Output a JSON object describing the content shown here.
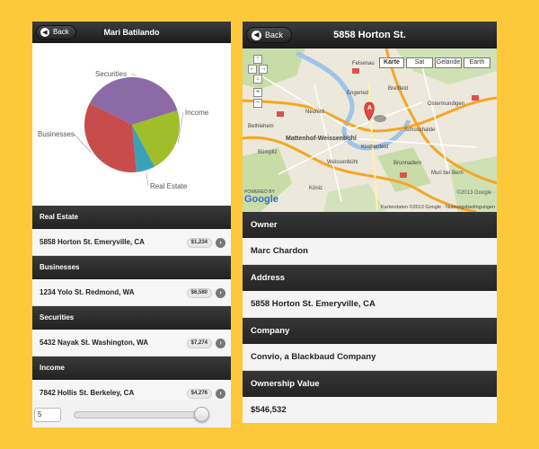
{
  "left": {
    "header": {
      "back_label": "Back",
      "title": "Mari Batilando"
    },
    "chart_data": {
      "type": "pie",
      "slices": [
        {
          "label": "Securities",
          "value": 7274,
          "color": "#8b6aa6"
        },
        {
          "label": "Income",
          "value": 4276,
          "color": "#9fbe2a"
        },
        {
          "label": "Real Estate",
          "value": 1234,
          "color": "#3ba1b8"
        },
        {
          "label": "Businesses",
          "value": 6580,
          "color": "#c74d4d"
        }
      ]
    },
    "sections": [
      {
        "title": "Real Estate",
        "address": "5858 Horton St. Emeryville, CA",
        "badge": "$1,234"
      },
      {
        "title": "Businesses",
        "address": "1234 Yolo St. Redmond, WA",
        "badge": "$6,580"
      },
      {
        "title": "Securities",
        "address": "5432 Nayak St. Washington, WA",
        "badge": "$7,274"
      },
      {
        "title": "Income",
        "address": "7842 Hollis St. Berkeley, CA",
        "badge": "$4,276"
      }
    ],
    "slider": {
      "value": "5",
      "position": 1.0
    }
  },
  "right": {
    "header": {
      "back_label": "Back",
      "title": "5858 Horton St."
    },
    "map": {
      "types": [
        "Karte",
        "Sat",
        "Gelände",
        "Earth"
      ],
      "labels": {
        "felsenau": "Felsenau",
        "breitfeld": "Breitfeld",
        "engeried": "Engeried",
        "ostermundigen": "Ostermundigen",
        "neufeld": "Neufeld",
        "bethlehem": "Bethlehem",
        "mattenhof": "Mattenhof-Weissenbühl",
        "kirchenfeld": "Kirchenfeld",
        "schosshalde": "Schosshalde",
        "bumpliz": "Bümpliz",
        "weissenbuhl": "Weissenbühl",
        "brunnadern": "Brunnadern",
        "muri": "Muri bei Bern",
        "koniz": "Köniz"
      },
      "marker": "A",
      "powered_by": "POWERED BY",
      "google": "Google",
      "copyright": "©2013 Google ·",
      "footer": "Kartendaten ©2013 Google · Nutzungsbedingungen"
    },
    "fields": [
      {
        "label": "Owner",
        "value": "Marc Chardon"
      },
      {
        "label": "Address",
        "value": "5858 Horton St. Emeryville, CA"
      },
      {
        "label": "Company",
        "value": "Convio, a Blackbaud Company"
      },
      {
        "label": "Ownership Value",
        "value": "$546,532"
      }
    ]
  }
}
